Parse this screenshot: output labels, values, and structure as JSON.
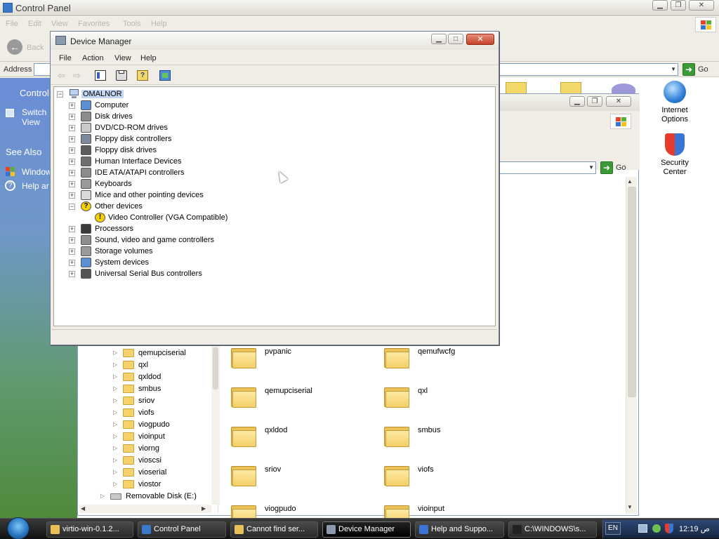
{
  "control_panel": {
    "title": "Control Panel",
    "menu": [
      "File",
      "Edit",
      "View",
      "Favorites",
      "Tools",
      "Help"
    ],
    "back_label": "Back",
    "address_label": "Address",
    "go_label": "Go",
    "left_pane": {
      "heading": "Control",
      "switch_view": [
        "Switch",
        "View"
      ],
      "see_also": "See Also",
      "links": [
        "Window",
        "Help ar"
      ]
    },
    "icons": [
      {
        "name": "Internet Options",
        "lines": [
          "Internet",
          "Options"
        ],
        "icon": "globe-icon"
      },
      {
        "name": "Security Center",
        "lines": [
          "Security",
          "Center"
        ],
        "icon": "shield-icon"
      }
    ]
  },
  "explorer": {
    "go_label": "Go",
    "tree": [
      {
        "label": "qemupciserial",
        "type": "folder"
      },
      {
        "label": "qxl",
        "type": "folder"
      },
      {
        "label": "qxldod",
        "type": "folder"
      },
      {
        "label": "smbus",
        "type": "folder"
      },
      {
        "label": "sriov",
        "type": "folder"
      },
      {
        "label": "viofs",
        "type": "folder"
      },
      {
        "label": "viogpudo",
        "type": "folder"
      },
      {
        "label": "vioinput",
        "type": "folder"
      },
      {
        "label": "viorng",
        "type": "folder"
      },
      {
        "label": "vioscsi",
        "type": "folder"
      },
      {
        "label": "vioserial",
        "type": "folder"
      },
      {
        "label": "viostor",
        "type": "folder"
      },
      {
        "label": "Removable Disk (E:)",
        "type": "drive"
      }
    ],
    "folders": [
      "pvpanic",
      "qemufwcfg",
      "qemupciserial",
      "qxl",
      "qxldod",
      "smbus",
      "sriov",
      "viofs",
      "viogpudo",
      "vioinput"
    ]
  },
  "device_manager": {
    "title": "Device Manager",
    "menu": [
      "File",
      "Action",
      "View",
      "Help"
    ],
    "computer_name": "OMALNOR",
    "categories": [
      {
        "label": "Computer",
        "expanded": false,
        "icon": "computer-icon"
      },
      {
        "label": "Disk drives",
        "expanded": false,
        "icon": "disk-icon"
      },
      {
        "label": "DVD/CD-ROM drives",
        "expanded": false,
        "icon": "cdrom-icon"
      },
      {
        "label": "Floppy disk controllers",
        "expanded": false,
        "icon": "controller-icon"
      },
      {
        "label": "Floppy disk drives",
        "expanded": false,
        "icon": "floppy-icon"
      },
      {
        "label": "Human Interface Devices",
        "expanded": false,
        "icon": "hid-icon"
      },
      {
        "label": "IDE ATA/ATAPI controllers",
        "expanded": false,
        "icon": "ide-icon"
      },
      {
        "label": "Keyboards",
        "expanded": false,
        "icon": "keyboard-icon"
      },
      {
        "label": "Mice and other pointing devices",
        "expanded": false,
        "icon": "mouse-icon"
      },
      {
        "label": "Other devices",
        "expanded": true,
        "icon": "unknown-device-icon"
      },
      {
        "label": "Video Controller (VGA Compatible)",
        "child": true,
        "icon": "warning-device-icon"
      },
      {
        "label": "Processors",
        "expanded": false,
        "icon": "processor-icon"
      },
      {
        "label": "Sound, video and game controllers",
        "expanded": false,
        "icon": "sound-icon"
      },
      {
        "label": "Storage volumes",
        "expanded": false,
        "icon": "storage-icon"
      },
      {
        "label": "System devices",
        "expanded": false,
        "icon": "system-icon"
      },
      {
        "label": "Universal Serial Bus controllers",
        "expanded": false,
        "icon": "usb-icon"
      }
    ]
  },
  "taskbar": {
    "tasks": [
      {
        "label": "virtio-win-0.1.2...",
        "active": false
      },
      {
        "label": "Control Panel",
        "active": false
      },
      {
        "label": "Cannot find ser...",
        "active": false
      },
      {
        "label": "Device Manager",
        "active": true
      },
      {
        "label": "Help and Suppo...",
        "active": false
      },
      {
        "label": "C:\\WINDOWS\\s...",
        "active": false
      }
    ],
    "language": "EN",
    "clock": "12:19 ص"
  },
  "colors": {
    "taskbar": "#111111",
    "accent": "#3b9a36",
    "warning": "#f5d000",
    "selection": "#c4d7f0"
  }
}
